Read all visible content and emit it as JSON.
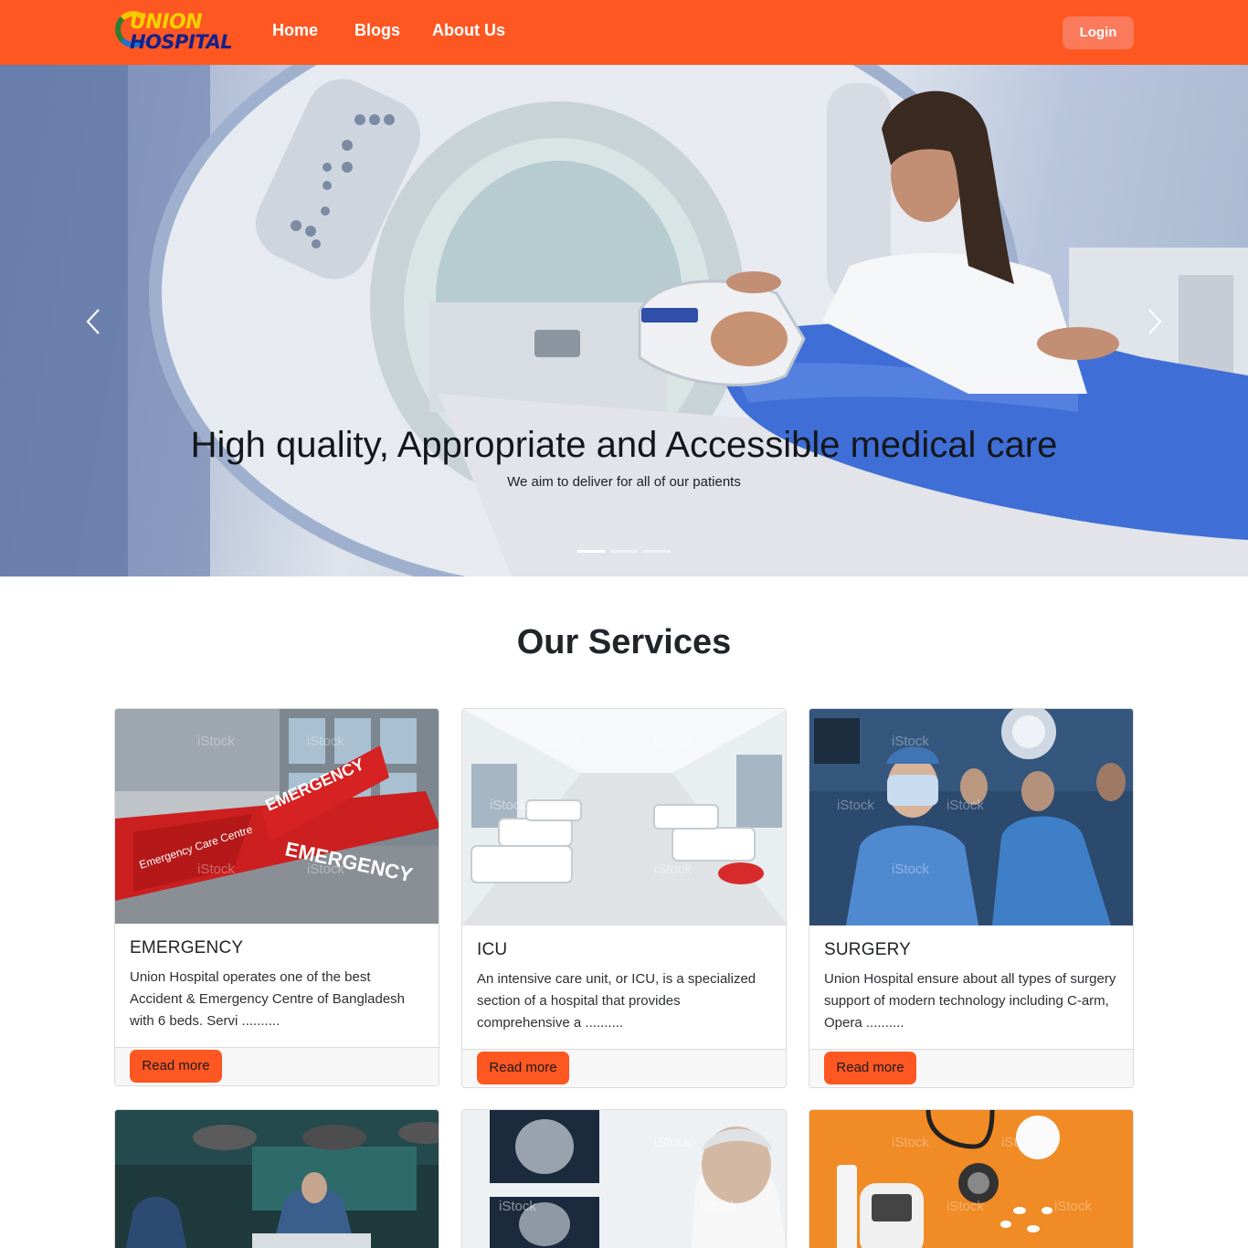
{
  "brand": {
    "line1": "UNION",
    "line2": "HOSPITAL"
  },
  "nav": {
    "home": "Home",
    "blogs": "Blogs",
    "about": "About Us",
    "login": "Login"
  },
  "hero": {
    "title": "High quality, Appropriate and Accessible medical care",
    "subtitle": "We aim to deliver for all of our patients",
    "slide_count": 3,
    "active_slide": 1
  },
  "services": {
    "heading": "Our Services",
    "cards": [
      {
        "title": "EMERGENCY",
        "text": "Union Hospital operates one of the best Accident & Emergency Centre of Bangladesh with 6 beds. Servi ..........",
        "button": "Read more",
        "sign1": "EMERGENCY",
        "sign2": "EMERGENCY",
        "sign3": "Emergency Care Centre"
      },
      {
        "title": "ICU",
        "text": "An intensive care unit, or ICU, is a specialized section of a hospital that provides comprehensive a ..........",
        "button": "Read more"
      },
      {
        "title": "SURGERY",
        "text": "Union Hospital ensure about all types of surgery support of modern technology including C-arm, Opera ..........",
        "button": "Read more"
      }
    ],
    "watermark": "iStock"
  },
  "colors": {
    "primary": "#fe5722",
    "login_bg": "#fb7a5c",
    "footer_bg": "#f7f7f7"
  }
}
